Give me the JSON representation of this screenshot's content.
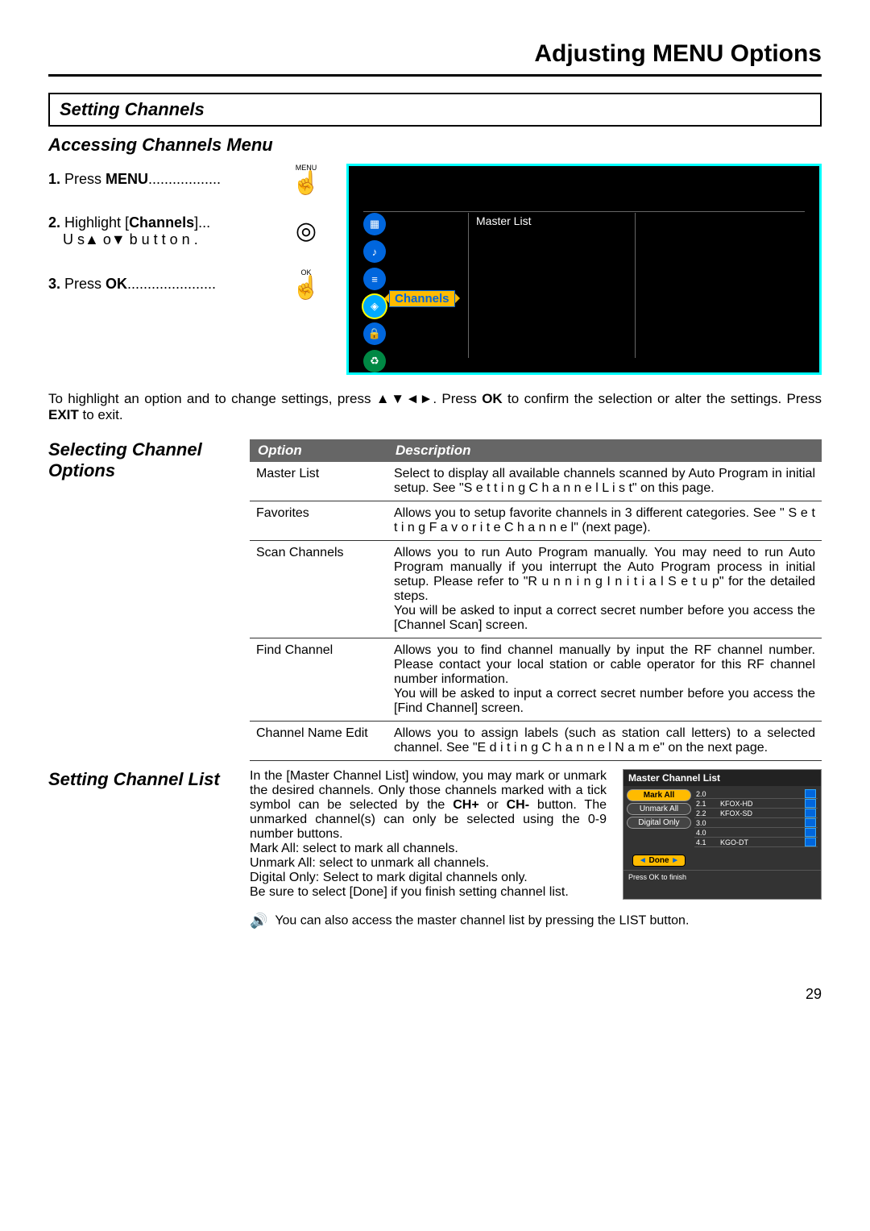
{
  "header": {
    "title": "Adjusting MENU Options"
  },
  "section1": {
    "box": "Setting Channels",
    "sub": "Accessing Channels Menu",
    "steps": {
      "s1_pre": "1. ",
      "s1_bold": "Press ",
      "s1_kw": "MENU",
      "s1_dots": "..................",
      "s2_pre": "2. ",
      "s2_a": "Highlight [",
      "s2_kw": "Channels",
      "s2_b": "]...",
      "s2_c": "U s▲ o▼  b u t t o n .",
      "s3_pre": "3. ",
      "s3_a": "Press ",
      "s3_kw": "OK",
      "s3_dots": "......................",
      "menu_lbl": "MENU",
      "ok_lbl": "OK"
    },
    "diagram": {
      "channels": "Channels",
      "master": "Master List"
    },
    "instr_a": "To highlight an option and to change settings, press ",
    "instr_arrows": "▲▼◄►",
    "instr_b": ". Press ",
    "instr_ok": "OK",
    "instr_c": " to confirm the selection or alter the settings. Press ",
    "instr_exit": "EXIT",
    "instr_d": " to exit."
  },
  "section2": {
    "head": "Selecting Channel Options",
    "th_opt": "Option",
    "th_desc": "Description",
    "rows": {
      "r0_o": "Master List",
      "r0_d": "Select to display all available channels scanned by Auto Program in initial setup. See \"S e t t i n g   C h a n n e l  L i s t\" on this page.",
      "r1_o": "Favorites",
      "r1_d": "Allows you to setup favorite channels in 3 different categories. See \" S e t t i n g  F a v o r i t e  C h a n n e l\" (next page).",
      "r2_o": "Scan Channels",
      "r2_d": "Allows you to run Auto Program manually. You may need to run Auto Program manually if you interrupt the Auto Program process in initial setup. Please refer to \"R u n n i n g  I n i t i a l  S e t u p\" for the detailed steps.\nYou will be asked to input a correct secret number before you access the [Channel Scan] screen.",
      "r3_o": "Find Channel",
      "r3_d": "Allows you to find channel manually by input the RF channel number. Please contact your local station or cable operator for this RF channel number information.\nYou will be asked to input a correct secret number before you access the [Find Channel] screen.",
      "r4_o": "Channel Name Edit",
      "r4_d": "Allows you to assign labels (such as station call letters) to a selected channel. See \"E d i t i n g  C h a n n e l  N a m e\" on the next page."
    }
  },
  "section3": {
    "head": "Setting Channel List",
    "p1_a": "In the [Master Channel List] window, you may mark or unmark the desired channels. Only those channels marked with a tick symbol can be selected by the ",
    "p1_chp": "CH+",
    "p1_or": " or ",
    "p1_chm": "CH-",
    "p1_b": " button. The unmarked channel(s) can only be selected using the 0-9 number buttons.",
    "p2": "Mark All: select to mark all channels.",
    "p3": "Unmark All: select to unmark all channels.",
    "p4": "Digital Only: Select to mark digital channels only.",
    "p5": "Be sure to select [Done] if you finish setting channel list.",
    "note": "You can also access the master channel list by pressing the LIST button.",
    "mcl": {
      "title": "Master Channel List",
      "markall": "Mark All",
      "unmarkall": "Unmark All",
      "digital": "Digital Only",
      "done": "Done",
      "foot": "Press OK to finish",
      "channels": [
        {
          "n": "2.0",
          "name": ""
        },
        {
          "n": "2.1",
          "name": "KFOX-HD"
        },
        {
          "n": "2.2",
          "name": "KFOX-SD"
        },
        {
          "n": "3.0",
          "name": ""
        },
        {
          "n": "4.0",
          "name": ""
        },
        {
          "n": "4.1",
          "name": "KGO-DT"
        }
      ]
    }
  },
  "page": "29"
}
